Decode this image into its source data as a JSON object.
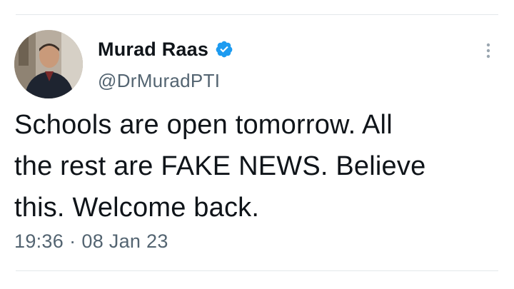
{
  "tweet": {
    "author": {
      "name": "Murad Raas",
      "handle": "@DrMuradPTI",
      "verified": true,
      "verified_color": "#1d9bf0"
    },
    "text_lines": [
      "Schools are open tomorrow. All",
      "the rest are FAKE NEWS. Believe",
      "this. Welcome back."
    ],
    "time": "19:36",
    "separator": "·",
    "date": "08 Jan 23",
    "icons": {
      "avatar": "profile-photo",
      "badge": "verified-badge-icon",
      "more": "more-vertical-icon"
    }
  }
}
